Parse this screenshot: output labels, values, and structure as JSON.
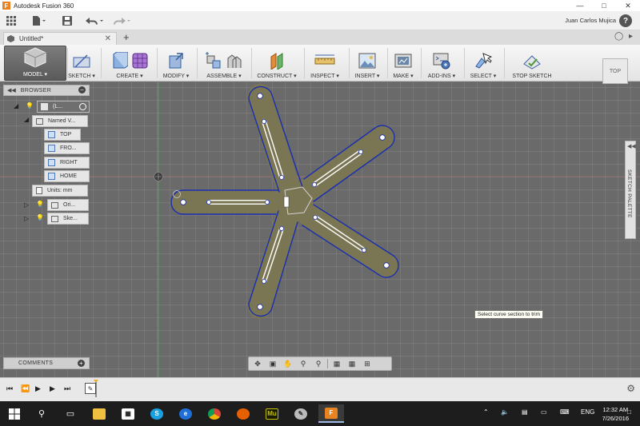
{
  "window": {
    "title": "Autodesk Fusion 360",
    "controls": [
      "—",
      "□",
      "✕"
    ]
  },
  "quickaccess": {
    "user": "Juan Carlos Mujica",
    "help": "?"
  },
  "doc_tab": {
    "title": "Untitled*",
    "close": "✕"
  },
  "toolbar": {
    "groups": [
      {
        "label": "MODEL ▾"
      },
      {
        "label": "SKETCH ▾"
      },
      {
        "label": "CREATE ▾"
      },
      {
        "label": "MODIFY ▾"
      },
      {
        "label": "ASSEMBLE ▾"
      },
      {
        "label": "CONSTRUCT ▾"
      },
      {
        "label": "INSPECT ▾"
      },
      {
        "label": "INSERT ▾"
      },
      {
        "label": "MAKE ▾"
      },
      {
        "label": "ADD-INS ▾"
      },
      {
        "label": "SELECT ▾"
      },
      {
        "label": "STOP SKETCH"
      }
    ],
    "viewcube": "TOP"
  },
  "browser": {
    "title": "BROWSER",
    "root": "(L...",
    "named_views": "Named V...",
    "views": [
      "TOP",
      "FRO...",
      "RIGHT",
      "HOME"
    ],
    "units": "Units: mm",
    "origin": "Ori...",
    "sketches": "Ske..."
  },
  "comments": {
    "title": "COMMENTS"
  },
  "palette": {
    "title": "SKETCH PALETTE"
  },
  "tooltip": {
    "text": "Select curve section to trim"
  },
  "taskbar": {
    "tray_lang": "ENG",
    "time": "12:32 AM",
    "date": "7/26/2016",
    "apps": [
      "windows-logo",
      "search",
      "task-view",
      "file-explorer",
      "store",
      "skype",
      "edge",
      "chrome",
      "firefox",
      "muse",
      "inkscape",
      "fusion"
    ]
  },
  "colors": {
    "sketch_fill": "#7a7553",
    "sketch_stroke": "#1a2fb0",
    "canvas": "#6a6a6a",
    "model_button": "#5f5f5f"
  }
}
